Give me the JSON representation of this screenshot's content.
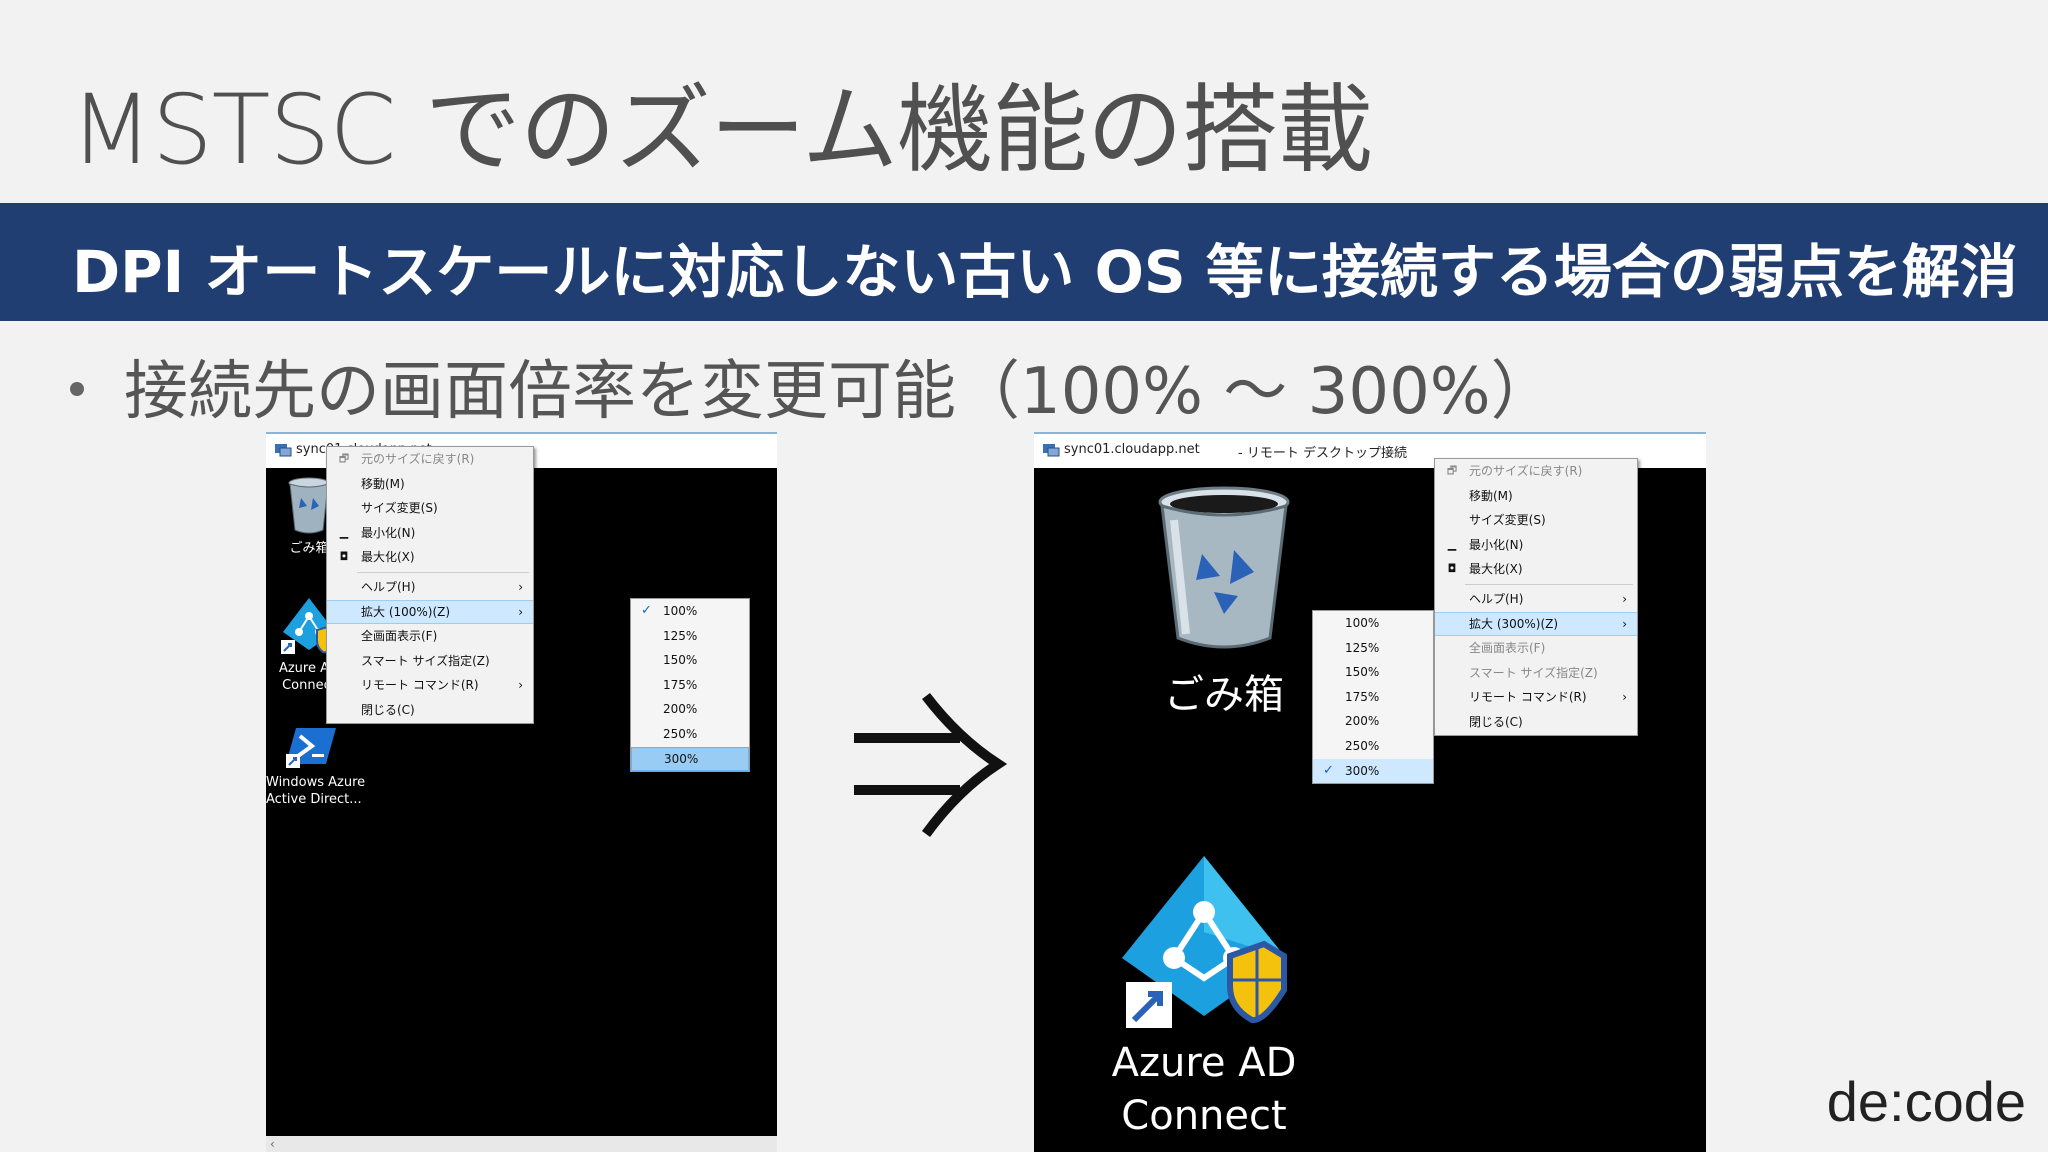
{
  "slide": {
    "title": "MSTSC でのズーム機能の搭載",
    "banner": "DPI オートスケールに対応しない古い OS 等に接続する場合の弱点を解消",
    "bullet": "接続先の画面倍率を変更可能（100% ～ 300%）",
    "arrow_glyph": "⇒",
    "logo": "de:code"
  },
  "left_window": {
    "title_host": "sync01.cloudapp.net",
    "desktop_items": [
      {
        "label_line1": "ごみ箱",
        "label_line2": "",
        "icon": "recycle-bin-icon"
      },
      {
        "label_line1": "Azure AD",
        "label_line2": "Connect",
        "icon": "azure-ad-connect-icon"
      },
      {
        "label_line1": "Windows Azure",
        "label_line2": "Active Direct...",
        "icon": "powershell-icon"
      }
    ],
    "menu": {
      "items": [
        {
          "label": "元のサイズに戻す(R)",
          "glyph": "restore-icon",
          "disabled": true
        },
        {
          "label": "移動(M)"
        },
        {
          "label": "サイズ変更(S)"
        },
        {
          "label": "最小化(N)",
          "glyph": "minimize-icon"
        },
        {
          "label": "最大化(X)",
          "glyph": "maximize-icon"
        },
        {
          "label": "ヘルプ(H)",
          "submenu": true
        },
        {
          "label": "拡大 (100%)(Z)",
          "submenu": true,
          "active": true
        },
        {
          "label": "全画面表示(F)"
        },
        {
          "label": "スマート サイズ指定(Z)"
        },
        {
          "label": "リモート コマンド(R)",
          "submenu": true
        },
        {
          "label": "閉じる(C)"
        }
      ]
    },
    "zoom_options": [
      "100%",
      "125%",
      "150%",
      "175%",
      "200%",
      "250%",
      "300%"
    ],
    "zoom_checked": "100%",
    "zoom_highlighted": "300%",
    "scroll_left_glyph": "‹"
  },
  "right_window": {
    "title_host": "sync01.cloudapp.net",
    "title_suffix": "- リモート デスクトップ接続",
    "desktop_items": [
      {
        "label_line1": "ごみ箱",
        "label_line2": "",
        "icon": "recycle-bin-icon"
      },
      {
        "label_line1": "Azure AD",
        "label_line2": "Connect",
        "icon": "azure-ad-connect-icon"
      }
    ],
    "menu": {
      "items": [
        {
          "label": "元のサイズに戻す(R)",
          "glyph": "restore-icon",
          "disabled": true
        },
        {
          "label": "移動(M)"
        },
        {
          "label": "サイズ変更(S)"
        },
        {
          "label": "最小化(N)",
          "glyph": "minimize-icon"
        },
        {
          "label": "最大化(X)",
          "glyph": "maximize-icon"
        },
        {
          "label": "ヘルプ(H)",
          "submenu": true
        },
        {
          "label": "拡大 (300%)(Z)",
          "submenu": true,
          "active": true
        },
        {
          "label": "全画面表示(F)",
          "disabled": true
        },
        {
          "label": "スマート サイズ指定(Z)",
          "disabled": true
        },
        {
          "label": "リモート コマンド(R)",
          "submenu": true
        },
        {
          "label": "閉じる(C)"
        }
      ]
    },
    "zoom_options": [
      "100%",
      "125%",
      "150%",
      "175%",
      "200%",
      "250%",
      "300%"
    ],
    "zoom_checked": "300%"
  },
  "colors": {
    "banner": "#213e72",
    "menu_highlight": "#cde8ff",
    "submenu_highlight": "#99ccf5",
    "azure_blue": "#1ca0e0"
  }
}
